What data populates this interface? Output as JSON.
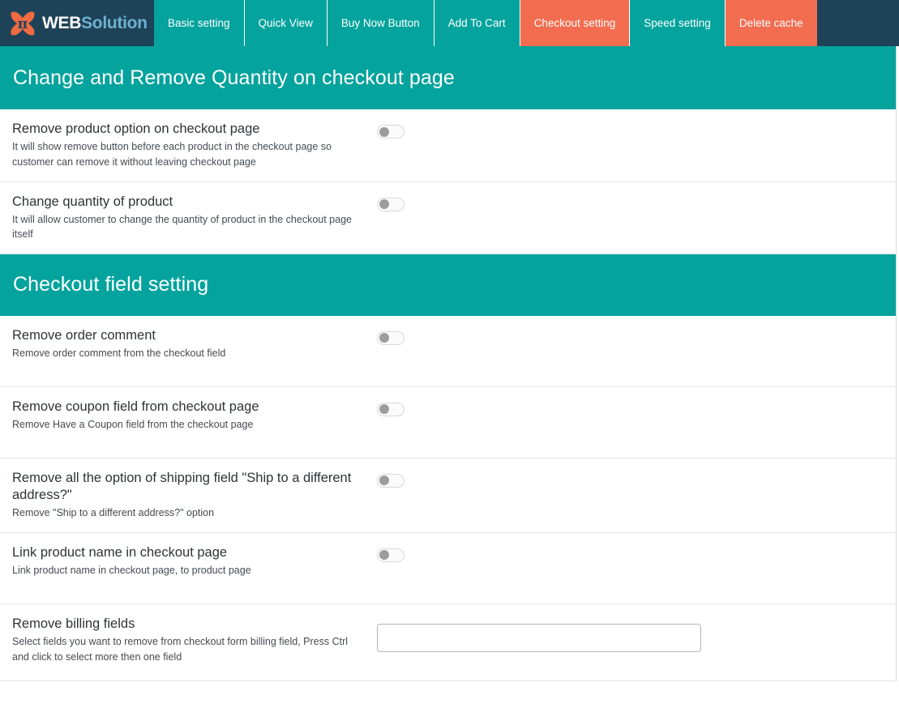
{
  "brand": {
    "logo_icon": "pi-x-logo-icon",
    "name_primary": "WEB",
    "name_secondary": "Solution"
  },
  "colors": {
    "navy": "#1e4258",
    "teal": "#05a39d",
    "orange": "#f26c4f",
    "text_dark": "#2e3338",
    "border": "#e4e4e4"
  },
  "nav": {
    "tabs": [
      {
        "label": "Basic setting",
        "active": false
      },
      {
        "label": "Quick View",
        "active": false
      },
      {
        "label": "Buy Now Button",
        "active": false
      },
      {
        "label": "Add To Cart",
        "active": false
      },
      {
        "label": "Checkout setting",
        "active": true
      },
      {
        "label": "Speed setting",
        "active": false
      },
      {
        "label": "Delete cache",
        "active": true
      }
    ]
  },
  "sections": [
    {
      "header": "Change and Remove Quantity on checkout page",
      "rows": [
        {
          "title": "Remove product option on checkout page",
          "desc": "It will show remove button before each product in the checkout page so customer can remove it without leaving checkout page",
          "control": "toggle",
          "value": "off"
        },
        {
          "title": "Change quantity of product",
          "desc": "It will allow customer to change the quantity of product in the checkout page itself",
          "control": "toggle",
          "value": "off"
        }
      ]
    },
    {
      "header": "Checkout field setting",
      "rows": [
        {
          "title": "Remove order comment",
          "desc": "Remove order comment from the checkout field",
          "control": "toggle",
          "value": "off"
        },
        {
          "title": "Remove coupon field from checkout page",
          "desc": "Remove Have a Coupon field from the checkout page",
          "control": "toggle",
          "value": "off"
        },
        {
          "title": "Remove all the option of shipping field \"Ship to a different address?\"",
          "desc": "Remove \"Ship to a different address?\" option",
          "control": "toggle",
          "value": "off"
        },
        {
          "title": "Link product name in checkout page",
          "desc": "Link product name in checkout page, to product page",
          "control": "toggle",
          "value": "off"
        },
        {
          "title": "Remove billing fields",
          "desc": "Select fields you want to remove from checkout form billing field, Press Ctrl and click to select more then one field",
          "control": "multiselect",
          "value": "",
          "placeholder": ""
        }
      ]
    }
  ]
}
